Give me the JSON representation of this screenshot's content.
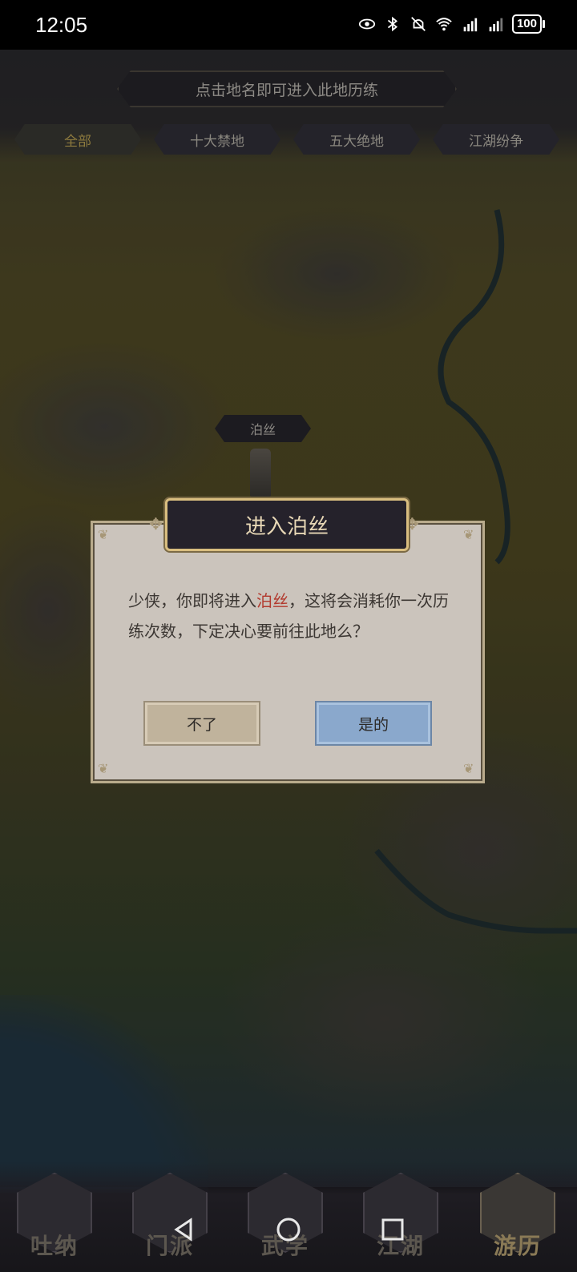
{
  "status_bar": {
    "time": "12:05",
    "battery": "100",
    "icons": [
      "eye-icon",
      "bluetooth-icon",
      "mute-icon",
      "wifi-icon",
      "signal-4g-icon",
      "signal-4g-icon"
    ]
  },
  "map": {
    "hint": "点击地名即可进入此地历练",
    "tabs": [
      {
        "label": "全部",
        "active": true
      },
      {
        "label": "十大禁地",
        "active": false
      },
      {
        "label": "五大绝地",
        "active": false
      },
      {
        "label": "江湖纷争",
        "active": false
      }
    ],
    "location_label": "泊丝"
  },
  "dialog": {
    "title": "进入泊丝",
    "message_before": "少侠，你即将进入",
    "message_highlight": "泊丝",
    "message_after": "，这将会消耗你一次历练次数，下定决心要前往此地么？",
    "cancel_label": "不了",
    "confirm_label": "是的"
  },
  "bottom_nav": {
    "items": [
      {
        "label": "吐纳",
        "active": false
      },
      {
        "label": "门派",
        "active": false
      },
      {
        "label": "武学",
        "active": false
      },
      {
        "label": "江湖",
        "active": false
      },
      {
        "label": "游历",
        "active": true
      }
    ]
  },
  "colors": {
    "highlight": "#b23a2e",
    "confirm_button": "#8aa8cc",
    "cancel_button": "#c0b39c",
    "title_gold": "#d9be80"
  }
}
